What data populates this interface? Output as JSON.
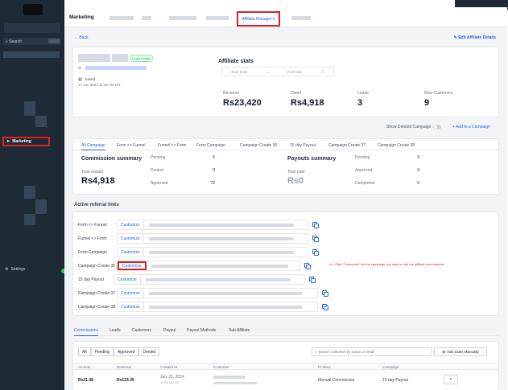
{
  "sidebar": {
    "search_placeholder": "Search",
    "active_item": "Marketing",
    "settings": "Settings"
  },
  "header": {
    "title": "Marketing",
    "active_tab": "Affiliate Manager"
  },
  "back": "Back",
  "edit_link": "Edit Affiliate Details",
  "affiliate": {
    "status": "Login Details",
    "joined_label": "Joined",
    "joined_date": "17 Jun 2024 11:25 AM IST"
  },
  "stats": {
    "title": "Affiliate stats",
    "start_placeholder": "Start Date",
    "end_placeholder": "End Date",
    "items": [
      {
        "label": "Revenue",
        "value": "Rs23,420"
      },
      {
        "label": "Owed",
        "value": "Rs4,918"
      },
      {
        "label": "Leads",
        "value": "3"
      },
      {
        "label": "New Customers",
        "value": "9"
      }
    ]
  },
  "controls": {
    "show_deleted": "Show Deleted Campaign",
    "add_campaign": "+ Add to a Campaign"
  },
  "campaign_tabs": [
    "All Campaign",
    "Form <> Funnel",
    "Funnel <> Form",
    "Form Campaign",
    "Campaign Create 36",
    "15 day Payout",
    "Campaign Create 37",
    "Campaign Create 38"
  ],
  "commission": {
    "title": "Commission summary",
    "total_label": "Total unpaid",
    "total_value": "Rs4,918",
    "rows": [
      {
        "label": "Pending",
        "value": "5"
      },
      {
        "label": "Denied",
        "value": "0"
      },
      {
        "label": "Approved",
        "value": "72"
      }
    ]
  },
  "payouts": {
    "title": "Payouts summary",
    "total_label": "Total paid",
    "total_value": "Rs0",
    "rows": [
      {
        "label": "Pending",
        "value": "3"
      },
      {
        "label": "Approved",
        "value": "3"
      },
      {
        "label": "Completed",
        "value": "0"
      }
    ]
  },
  "links": {
    "title": "Active referral links",
    "customize": "Customize",
    "rows": [
      "Form <> Funnel",
      "Funnel <> Form",
      "Form Campaign",
      "Campaign Create 35",
      "15 day Payout",
      "Campaign Create 37",
      "Campaign Create 38"
    ],
    "annotation": "Click \"Customize\" for the campaign you want to edit the affiliate commissions"
  },
  "bottom_tabs": [
    "Commissions",
    "Leads",
    "Customers",
    "Payout",
    "Payout Methods",
    "Sub Affiliate"
  ],
  "filters": {
    "chips": [
      "All",
      "Pending",
      "Approved",
      "Denied"
    ],
    "search_placeholder": "Search customer by name or email",
    "add_sales": "Add Sales Manually"
  },
  "table": {
    "headers": [
      "Amount",
      "Revenue",
      "Created At",
      "Customer",
      "Product",
      "Campaign"
    ],
    "row": {
      "amount": "Rs21.38",
      "revenue": "Rs133.39",
      "created": "July 23, 2024",
      "created_time": "10:55 AM IST",
      "product": "Manual Commission",
      "campaign": "15 day Payout",
      "action": "×"
    }
  },
  "colors": {
    "accent": "#2563eb",
    "sidebar": "#1f2a37",
    "highlight": "#e02020"
  }
}
